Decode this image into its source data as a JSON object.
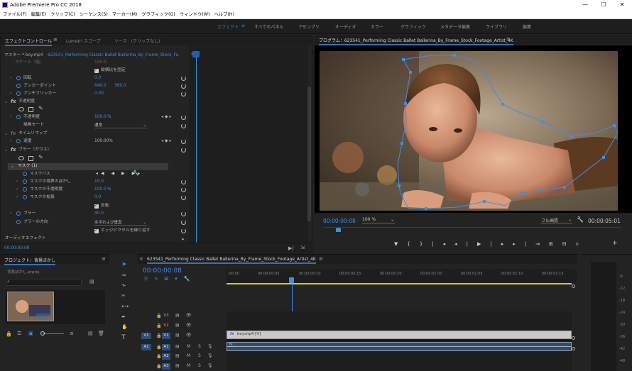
{
  "window": {
    "title": "Adobe Premiere Pro CC 2018"
  },
  "menu": [
    "ファイル(F)",
    "編集(E)",
    "クリップ(C)",
    "シーケンス(S)",
    "マーカー(M)",
    "グラフィック(G)",
    "ウィンドウ(W)",
    "ヘルプ(H)"
  ],
  "workspaces": [
    "エフェクト",
    "すべてのパネル",
    "アセンブリ",
    "オーディオ",
    "カラー",
    "グラフィック",
    "メタデータ編集",
    "ライブラリ",
    "編集"
  ],
  "effect_controls": {
    "tabs": [
      "エフェクトコントロール",
      "Lumetri スコープ",
      "ソース：(クリップなし)"
    ],
    "master_clip": "マスター * boy.mp4",
    "sequence_clip": "623541_Performing Classic Ballet Ballerina_By_Frame_Stock_Fo...",
    "scale_label": "スケール（幅）",
    "scale_value": "100.0",
    "uniform_scale": "縦横比を固定",
    "rotation_label": "回転",
    "rotation_value": "0.0",
    "anchor_label": "アンカーポイント",
    "anchor_x": "640.0",
    "anchor_y": "360.0",
    "flicker_label": "アンチフリッカー",
    "flicker_value": "0.00",
    "opacity_section": "不透明度",
    "opacity_label": "不透明度",
    "opacity_value": "100.0",
    "opacity_unit": "%",
    "blend_label": "描画モード",
    "blend_value": "通常",
    "time_remap_section": "タイムリマップ",
    "speed_label": "速度",
    "speed_value": "100.00%",
    "blur_section": "ブラー（ガウス）",
    "mask_label": "マスク (1)",
    "mask_path_label": "マスクパス",
    "mask_feather_label": "マスクの境界のぼかし",
    "mask_feather_value": "10.0",
    "mask_opacity_label": "マスクの不透明度",
    "mask_opacity_value": "100.0",
    "mask_opacity_unit": "%",
    "mask_expansion_label": "マスクの拡張",
    "mask_expansion_value": "0.0",
    "inverted_label": "反転",
    "blurriness_label": "ブラー",
    "blurriness_value": "40.0",
    "blur_dim_label": "ブラーの方向",
    "blur_dim_value": "水平および垂直",
    "repeat_edge_label": "エッジピクセルを繰り返す",
    "audio_effects_label": "オーディオエフェクト",
    "timecode": "00:00:00:08",
    "ruler_start": ":00"
  },
  "program_monitor": {
    "title": "プログラム：623541_Performing Classic Ballet Ballerina_By_Frame_Stock_Footage_Artist_4K",
    "timecode": "00:00:00:08",
    "zoom": "100 %",
    "quality": "フル画質",
    "duration": "00:00:05:01"
  },
  "project": {
    "title": "プロジェクト：背景ぼかし",
    "file": "背景ぼかし.prproj"
  },
  "timeline": {
    "title": "623541_Performing Classic Ballet Ballerina_By_Frame_Stock_Footage_Artist_4K",
    "timecode": "00:00:00:08",
    "ticks": [
      ":00:00",
      "00:00:00:05",
      "00:00:00:10",
      "00:00:00:15",
      "00:00:00:20",
      "00:00:01:00",
      "00:00:01:05",
      "00:00:01:10",
      "00:00:01:15"
    ],
    "tracks": [
      {
        "name": "V3",
        "src": ""
      },
      {
        "name": "V2",
        "src": ""
      },
      {
        "name": "V1",
        "src": "V1"
      },
      {
        "name": "A1",
        "src": "A1"
      },
      {
        "name": "A2",
        "src": ""
      },
      {
        "name": "A3",
        "src": ""
      }
    ],
    "clip_name": "boy.mp4 [V]",
    "solo": "S",
    "mute": "M"
  },
  "meters": {
    "labels": [
      "-6",
      "-12",
      "-18",
      "-24",
      "-30",
      "-36",
      "-42",
      "-48"
    ]
  }
}
